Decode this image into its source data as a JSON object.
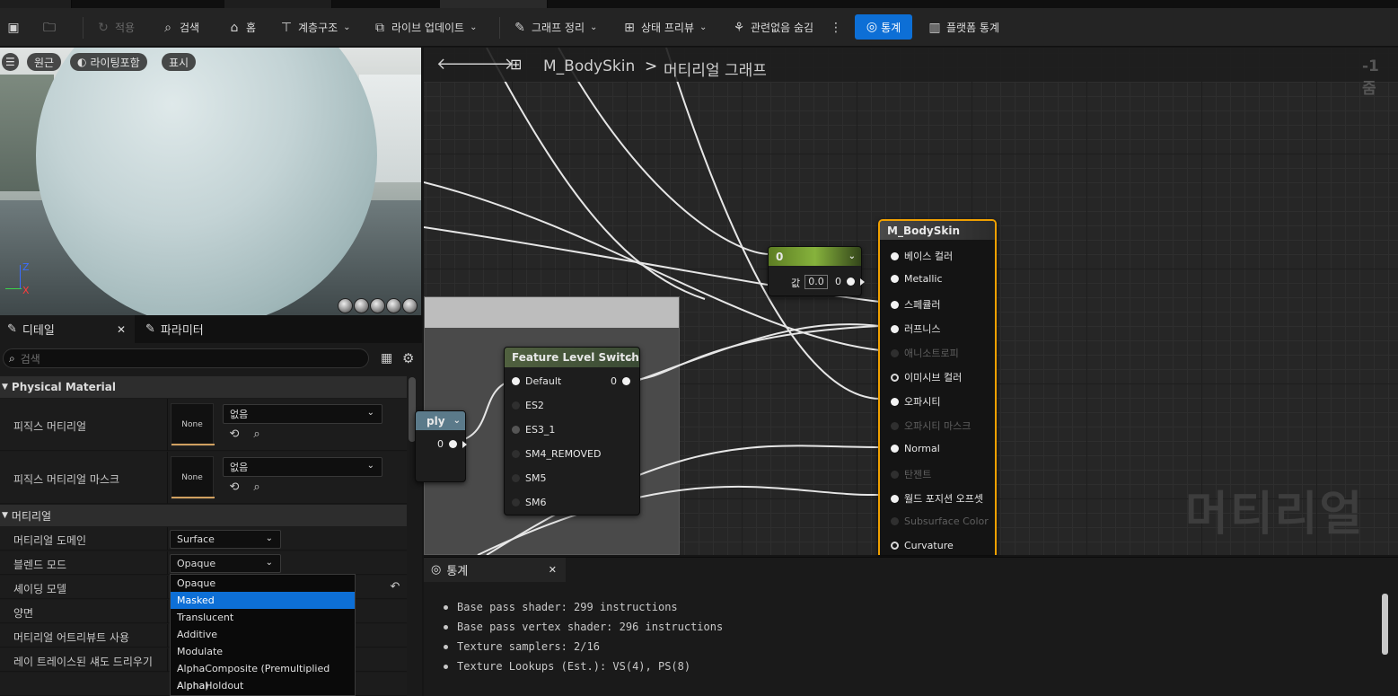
{
  "toolbar": {
    "apply": "적용",
    "search": "검색",
    "home": "홈",
    "hierarchy": "계층구조",
    "live_update": "라이브 업데이트",
    "graph_cleanup": "그래프 정리",
    "state_preview": "상태 프리뷰",
    "hide_unrelated": "관련없음 숨김",
    "stats": "통계",
    "platform_stats": "플랫폼 통계"
  },
  "viewport": {
    "perspective": "원근",
    "lighting": "라이팅포함",
    "show": "표시",
    "axis_z": "Z",
    "axis_x": "X"
  },
  "details": {
    "tab_details": "디테일",
    "tab_params": "파라미터",
    "search_placeholder": "검색",
    "section_physical": "Physical Material",
    "phys_material": "피직스 머티리얼",
    "phys_material_mask": "피직스 머티리얼 마스크",
    "none_thumb": "None",
    "none_value": "없음",
    "section_material": "머티리얼",
    "material_domain": "머티리얼 도메인",
    "material_domain_value": "Surface",
    "blend_mode": "블렌드 모드",
    "blend_mode_value": "Opaque",
    "shading_model": "셰이딩 모델",
    "two_sided": "양면",
    "use_material_attributes": "머티리얼 어트리뷰트 사용",
    "raytraced_shadows": "레이 트레이스된 섀도 드리우기"
  },
  "blend_dropdown": {
    "options": [
      "Opaque",
      "Masked",
      "Translucent",
      "Additive",
      "Modulate",
      "AlphaComposite (Premultiplied Alpha)",
      "AlphaHoldout"
    ],
    "highlighted": "Masked"
  },
  "graph": {
    "material_name": "M_BodySkin",
    "breadcrumb_sep": ">",
    "breadcrumb_graph": "머티리얼 그래프",
    "zoom": "-1 줌",
    "watermark": "머티리얼",
    "const_node": {
      "title": "0",
      "label": "값",
      "value": "0.0",
      "out": "0"
    },
    "fls_node": {
      "title": "Feature Level Switch",
      "pins": [
        "Default",
        "ES2",
        "ES3_1",
        "SM4_REMOVED",
        "SM5",
        "SM6"
      ],
      "out": "0"
    },
    "multiply_node": {
      "title": "ply",
      "out": "0"
    },
    "result_node": {
      "title": "M_BodySkin",
      "pins": [
        "베이스 컬러",
        "Metallic",
        "스페큘러",
        "러프니스",
        "애니소트로피",
        "이미시브 컬러",
        "오파시티",
        "오파시티 마스크",
        "Normal",
        "탄젠트",
        "월드 포지션 오프셋",
        "Subsurface Color",
        "Curvature"
      ]
    }
  },
  "stats_panel": {
    "tab": "통계",
    "lines": [
      "Base pass shader: 299 instructions",
      "Base pass vertex shader: 296 instructions",
      "Texture samplers: 2/16",
      "Texture Lookups (Est.): VS(4), PS(8)"
    ]
  },
  "colors": {
    "accent": "#0d6fd6",
    "node_selected_border": "#f0a000",
    "const_header": "#6a8f2d"
  }
}
